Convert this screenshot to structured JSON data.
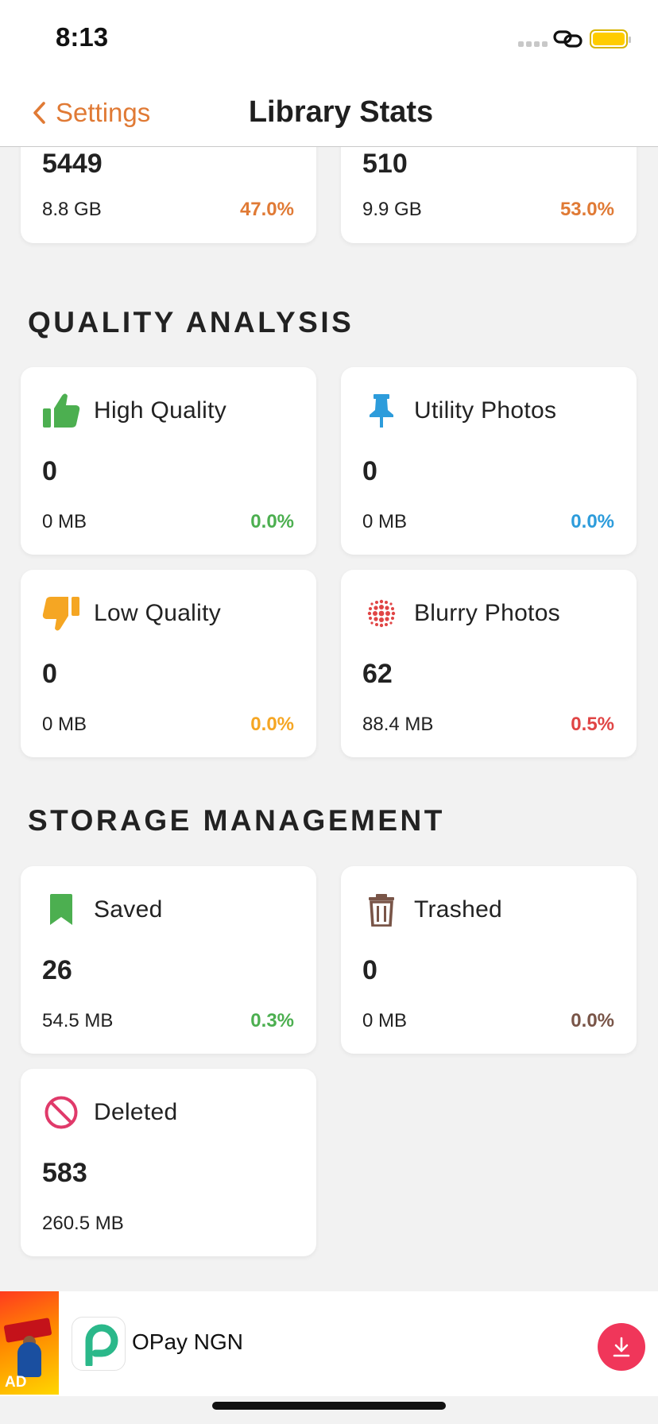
{
  "status_bar": {
    "time": "8:13"
  },
  "nav": {
    "back_label": "Settings",
    "title": "Library Stats"
  },
  "top_cards": [
    {
      "count": "5449",
      "size": "8.8 GB",
      "percent": "47.0%",
      "percent_color": "#e07a35"
    },
    {
      "count": "510",
      "size": "9.9 GB",
      "percent": "53.0%",
      "percent_color": "#e07a35"
    }
  ],
  "quality": {
    "heading": "QUALITY ANALYSIS",
    "cards": [
      {
        "title": "High Quality",
        "count": "0",
        "size": "0 MB",
        "percent": "0.0%",
        "icon": "thumbs-up-icon",
        "color": "#4caf50"
      },
      {
        "title": "Utility Photos",
        "count": "0",
        "size": "0 MB",
        "percent": "0.0%",
        "icon": "pin-icon",
        "color": "#2d9cdb"
      },
      {
        "title": "Low Quality",
        "count": "0",
        "size": "0 MB",
        "percent": "0.0%",
        "icon": "thumbs-down-icon",
        "color": "#f5a623"
      },
      {
        "title": "Blurry Photos",
        "count": "62",
        "size": "88.4 MB",
        "percent": "0.5%",
        "icon": "blur-icon",
        "color": "#e04545"
      }
    ]
  },
  "storage": {
    "heading": "STORAGE MANAGEMENT",
    "cards": [
      {
        "title": "Saved",
        "count": "26",
        "size": "54.5 MB",
        "percent": "0.3%",
        "icon": "bookmark-icon",
        "color": "#4caf50"
      },
      {
        "title": "Trashed",
        "count": "0",
        "size": "0 MB",
        "percent": "0.0%",
        "icon": "trash-icon",
        "color": "#795548"
      },
      {
        "title": "Deleted",
        "count": "583",
        "size": "260.5 MB",
        "icon": "prohibited-icon",
        "color": "#e03a6a"
      }
    ]
  },
  "ad": {
    "tag": "AD",
    "app_name": "OPay NGN",
    "button_color": "#f0365a"
  }
}
